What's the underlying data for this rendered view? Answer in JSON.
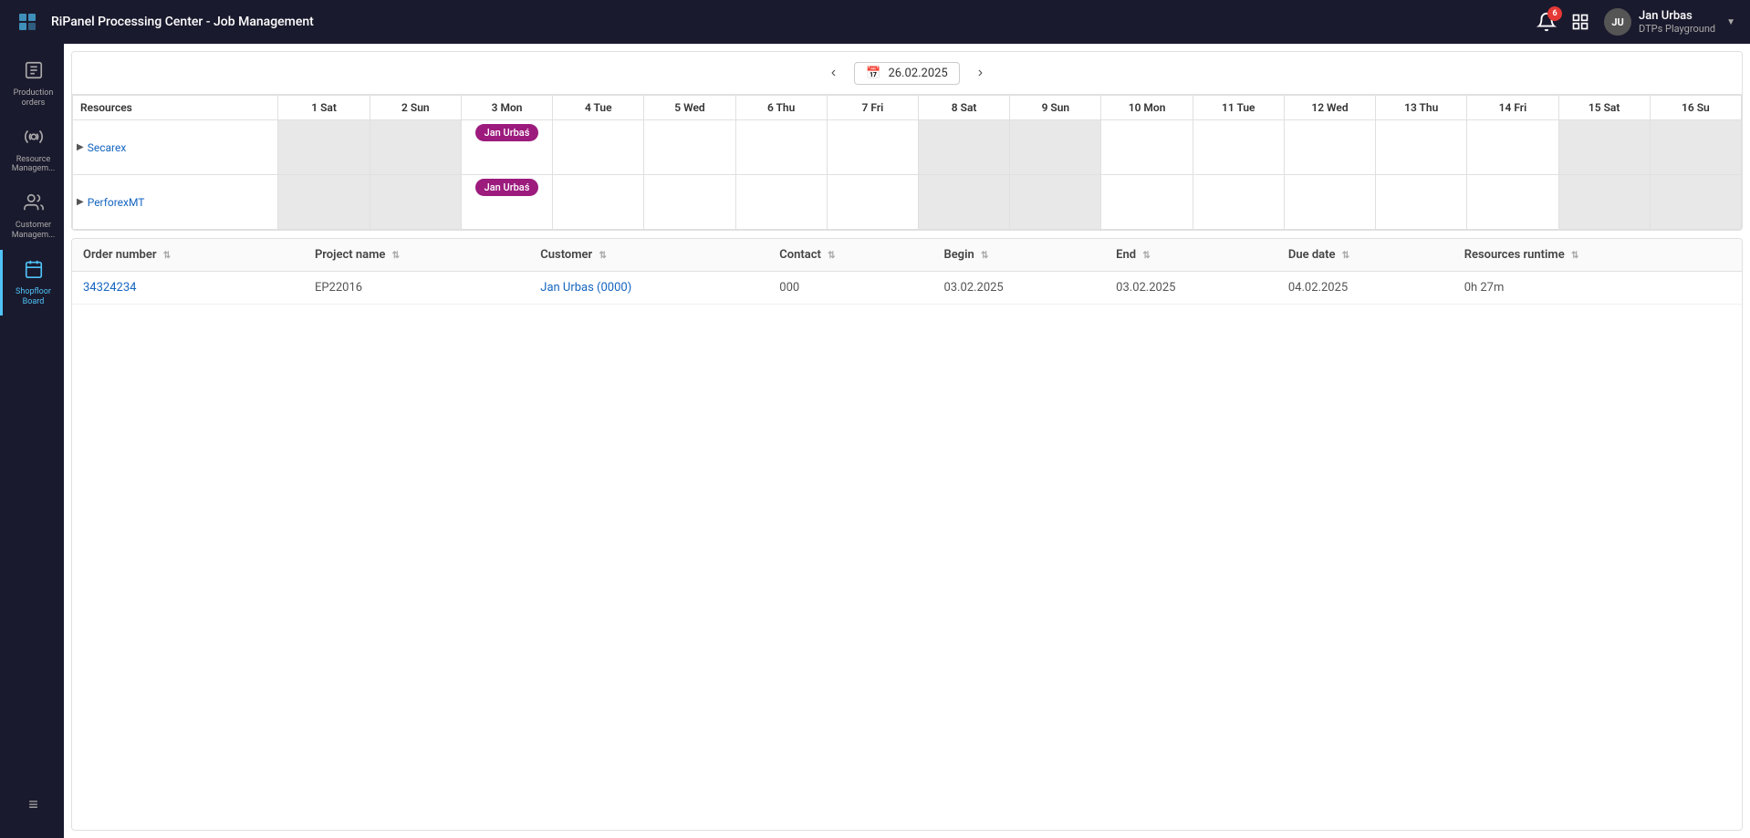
{
  "app": {
    "title": "RiPanel Processing Center - Job Management"
  },
  "header": {
    "notification_count": "6",
    "user": {
      "initials": "JU",
      "name": "Jan Urbas",
      "subtitle": "DTPs Playground"
    }
  },
  "sidebar": {
    "items": [
      {
        "id": "production-orders",
        "label": "Production orders",
        "icon": "🗒",
        "active": false
      },
      {
        "id": "resource-management",
        "label": "Resource Managem...",
        "icon": "⚙",
        "active": false
      },
      {
        "id": "customer-management",
        "label": "Customer Managem...",
        "icon": "👤",
        "active": false
      },
      {
        "id": "shopfloor-board",
        "label": "Shopfloor Board",
        "icon": "📅",
        "active": true
      }
    ],
    "bottom": {
      "menu_icon": "≡"
    }
  },
  "calendar": {
    "current_date": "26.02.2025",
    "columns": [
      {
        "day": "1",
        "label": "Sat",
        "weekend": true
      },
      {
        "day": "2",
        "label": "Sun",
        "weekend": true
      },
      {
        "day": "3",
        "label": "Mon",
        "weekend": false
      },
      {
        "day": "4",
        "label": "Tue",
        "weekend": false
      },
      {
        "day": "5",
        "label": "Wed",
        "weekend": false
      },
      {
        "day": "6",
        "label": "Thu",
        "weekend": false
      },
      {
        "day": "7",
        "label": "Fri",
        "weekend": false
      },
      {
        "day": "8",
        "label": "Sat",
        "weekend": true
      },
      {
        "day": "9",
        "label": "Sun",
        "weekend": true
      },
      {
        "day": "10",
        "label": "Mon",
        "weekend": false
      },
      {
        "day": "11",
        "label": "Tue",
        "weekend": false
      },
      {
        "day": "12",
        "label": "Wed",
        "weekend": false
      },
      {
        "day": "13",
        "label": "Thu",
        "weekend": false
      },
      {
        "day": "14",
        "label": "Fri",
        "weekend": false
      },
      {
        "day": "15",
        "label": "Sat",
        "weekend": true
      },
      {
        "day": "16",
        "label": "Su",
        "weekend": true
      }
    ],
    "resources": [
      {
        "name": "Secarex",
        "events": {
          "3": "Jan Urbas"
        }
      },
      {
        "name": "PerforexMT",
        "events": {
          "3": "Jan Urbas"
        }
      }
    ]
  },
  "table": {
    "columns": [
      {
        "id": "order_number",
        "label": "Order number"
      },
      {
        "id": "project_name",
        "label": "Project name"
      },
      {
        "id": "customer",
        "label": "Customer"
      },
      {
        "id": "contact",
        "label": "Contact"
      },
      {
        "id": "begin",
        "label": "Begin"
      },
      {
        "id": "end",
        "label": "End"
      },
      {
        "id": "due_date",
        "label": "Due date"
      },
      {
        "id": "resources_runtime",
        "label": "Resources runtime"
      }
    ],
    "rows": [
      {
        "order_number": "34324234",
        "project_name": "EP22016",
        "customer": "Jan Urbas (0000)",
        "contact": "000",
        "begin": "03.02.2025",
        "end": "03.02.2025",
        "due_date": "04.02.2025",
        "resources_runtime": "0h 27m"
      }
    ]
  }
}
